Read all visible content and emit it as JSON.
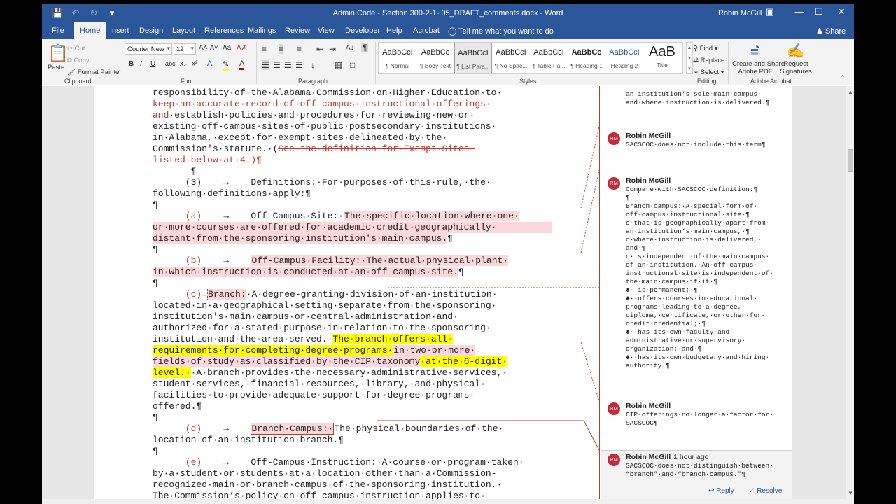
{
  "window": {
    "title": "Admin Code - Section 300-2-1-.05_DRAFT_comments.docx  -  Word",
    "user": "Robin McGill"
  },
  "qat": {
    "save_icon": "save-icon",
    "undo_icon": "undo-icon",
    "redo_icon": "redo-icon",
    "customize_icon": "customize-qat-icon"
  },
  "tabs": [
    {
      "label": "File"
    },
    {
      "label": "Home"
    },
    {
      "label": "Insert"
    },
    {
      "label": "Design"
    },
    {
      "label": "Layout"
    },
    {
      "label": "References"
    },
    {
      "label": "Mailings"
    },
    {
      "label": "Review"
    },
    {
      "label": "View"
    },
    {
      "label": "Developer"
    },
    {
      "label": "Help"
    },
    {
      "label": "Acrobat"
    }
  ],
  "tell_me": "Tell me what you want to do",
  "share": "Share",
  "ribbon": {
    "clipboard": {
      "label": "Clipboard",
      "paste": "Paste",
      "cut": "Cut",
      "copy": "Copy",
      "format_painter": "Format Painter"
    },
    "font": {
      "label": "Font",
      "font_name": "Courier New",
      "font_size": "12",
      "bold": "B",
      "italic": "I",
      "underline": "U",
      "strike": "abc",
      "subscript": "x₂",
      "superscript": "x²"
    },
    "paragraph": {
      "label": "Paragraph"
    },
    "styles": {
      "label": "Styles",
      "items": [
        {
          "sample": "AaBbCcI",
          "name": "¶ Normal"
        },
        {
          "sample": "AaBbCc",
          "name": "¶ Body Text"
        },
        {
          "sample": "AaBbCcI",
          "name": "¶ List Para..."
        },
        {
          "sample": "AaBbCcI",
          "name": "¶ No Spac..."
        },
        {
          "sample": "AaBbCcI",
          "name": "¶ Table Pa..."
        },
        {
          "sample": "AaBbCc",
          "name": "¶ Heading 1"
        },
        {
          "sample": "AaBbCcI",
          "name": "Heading 2"
        },
        {
          "sample": "AaB",
          "name": "Title"
        }
      ]
    },
    "editing": {
      "label": "Editing",
      "find": "Find",
      "replace": "Replace",
      "select": "Select"
    },
    "acrobat": {
      "label": "Adobe Acrobat",
      "create_share_line1": "Create and Share",
      "create_share_line2": "Adobe PDF",
      "request_sig_line1": "Request",
      "request_sig_line2": "Signatures"
    }
  },
  "document": {
    "l1": "responsibility·of·the·Alabama·Commission·on·Higher·Education·to·",
    "l2": "keep·an·accurate·record·of·off-campus·instructional·offerings·",
    "l3a": "and",
    "l3b": "·establish·policies·and·procedures·for·reviewing·new·or·",
    "l4": "existing·off-campus·sites·of·public·postsecondary·institutions·",
    "l5": "in·Alabama,·except·for·exempt·sites·delineated·by·the·",
    "l6a": "Commission's·statute.·(",
    "l6b": "See·the·definition·for·Exempt·Sites·",
    "l7a": "listed·below·at·4.)",
    "l7b": "¶",
    "l8": "       ¶",
    "l9": "      (3)    →    Definitions:·For·purposes·of·this·rule,·the·",
    "l10": "following·definitions·apply:¶",
    "p": "¶",
    "a_label": "      (a)",
    "a_mid": "    →    Off-Campus·Site:·",
    "a_c1": "The·specific·location·where·one·",
    "a_c2": "or·more·courses·are·offered·for·academic·credit·geographically·",
    "a_c3": "distant·from·the·sponsoring·institution's·main·campus.",
    "b_label": "      (b)",
    "b_mid": "    →    ",
    "b_c1": "Off-Campus·Facility:·The·actual·physical·plant·",
    "b_c2": "in·which·instruction·is·conducted·at·an·off-campus·site.",
    "c_label": "      (c)",
    "c_arrow": "→",
    "c_word": "Branch:",
    "c_rest": "·A·degree-granting·division·of·an·institution·",
    "c2": "located·in·a·geographical·setting·separate·from·the·sponsoring·",
    "c3": "institution's·main·campus·or·central·administration·and·",
    "c4": "authorized·for·a·stated·purpose·in·relation·to·the·sponsoring·",
    "c5a": "institution·and·the·area·served.·",
    "c5b": "The·branch·offers·all·",
    "c6a": "requirements·for·completing·degree·programs·",
    "c6b": "in·two·or·more·",
    "c7a": "fields·of·study·as·classified·by·the·CIP·taxonomy",
    "c7b": "·at·the·6-digit·",
    "c8a": "level.·",
    "c8b": "·A·branch·provides·the·necessary·administrative·services,·",
    "c9": "student·services,·financial·resources,·library,·and·physical·",
    "c10": "facilities·to·provide·adequate·support·for·degree·programs·",
    "c11": "offered.¶",
    "d_label": "      (d)",
    "d_mid": "    →    ",
    "d_c": "Branch·Campus:·",
    "d_rest": "The·physical·boundaries·of·the·",
    "d2": "location·of·an·institution·branch.¶",
    "e_label": "      (e)",
    "e_rest": "    →    Off-Campus·Instruction:·A·course·or·program·taken·",
    "e2": "by·a·student·or·students·at·a·location·other·than·a·Commission-",
    "e3": "recognized·main·or·branch·campus·of·the·sponsoring·institution.·",
    "e4": "The·Commission’s·policy·on·off-campus·instruction·applies·to·"
  },
  "comments": {
    "c0_body": "an·institution's·sole·main·campus·\nand·where·instruction·is·delivered.¶",
    "c1": {
      "initials": "RM",
      "author": "Robin McGill",
      "body": "SACSCOC·does·not·include·this·term¶"
    },
    "c2": {
      "initials": "RM",
      "author": "Robin McGill",
      "body": "Compare·with·SACSCOC·definition:¶\n¶\nBranch·campus:·A·special·form·of·\noff-campus·instructional·site·¶\no·that·is·geographically·apart·from·\nan·institution’s·main·campus,·¶\no·where·instruction·is·delivered,·\nand·¶\no·is·independent·of·the·main·campus·\nof·an·institution.·An·off-campus·\ninstructional·site·is·independent·of·\nthe·main·campus·if·it·¶\n♣··is·permanent;·¶\n♣··offers·courses·in·educational·\nprograms·leading·to·a·degree,·\ndiploma,·certificate,·or·other·for-\ncredit·credential;·¶\n♣··has·its·own·faculty·and·\nadministrative·or·supervisory·\norganization;·and·¶\n♣··has·its·own·budgetary·and·hiring·\nauthority.¶"
    },
    "c3": {
      "initials": "RM",
      "author": "Robin McGill",
      "body": "CIP·offerings·no·longer·a·factor·for·\nSACSCOC¶"
    },
    "c4": {
      "initials": "RM",
      "author": "Robin McGill",
      "time": "1 hour ago",
      "body": "SACSCOC·does·not·distinguish·between·\n“branch”·and·“branch·campus.”¶",
      "reply": "Reply",
      "resolve": "Resolve"
    }
  },
  "colors": {
    "accent": "#2b579a",
    "tracked_red": "#c0392b",
    "comment_highlight": "#fcd7dc",
    "yellow_highlight": "#ffff00",
    "avatar": "#c42b3a"
  }
}
